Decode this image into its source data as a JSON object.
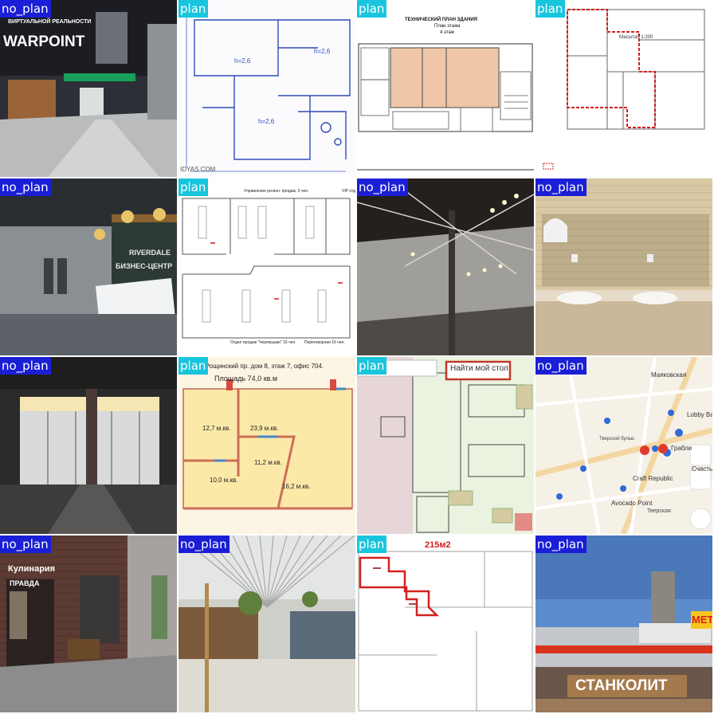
{
  "colors": {
    "plan_tag": "#18c5dd",
    "no_plan_tag": "#1a1fd6",
    "tag_text": "#ffffff"
  },
  "tiles": [
    {
      "label": "no_plan",
      "scene": "mall-storefront",
      "texts": {
        "banner": "WARPOINT",
        "banner_small": "ВИРТУАЛЬНОЙ РЕАЛЬНОСТИ"
      }
    },
    {
      "label": "plan",
      "scene": "hand-drawn-floor-plan",
      "texts": {
        "watermark": "IDYAS.COM",
        "h1": "h=2,6",
        "h2": "h=2,6",
        "h3": "h=2,6"
      }
    },
    {
      "label": "plan",
      "scene": "technical-floor-plan",
      "texts": {
        "title": "ТЕХНИЧЕСКИЙ ПЛАН ЗДАНИЯ",
        "subtitle": "План этажа",
        "floor": "4 этаж"
      }
    },
    {
      "label": "plan",
      "scene": "outlined-floor-plan",
      "texts": {
        "scale": "Масштаб 1:200"
      }
    },
    {
      "label": "no_plan",
      "scene": "business-center-lobby",
      "texts": {
        "sign1": "RIVERDALE",
        "sign2": "БИЗНЕС-ЦЕНТР"
      }
    },
    {
      "label": "plan",
      "scene": "office-layout-plan",
      "texts": {
        "room1": "Управление регион. продаж, 3 чел.",
        "room2": "VIP отд.",
        "room3": "Отдел продаж \"Черемушки\" 16 чел.",
        "room4": "Переговорная 16 чел."
      }
    },
    {
      "label": "no_plan",
      "scene": "empty-hall-track-lights",
      "texts": {}
    },
    {
      "label": "no_plan",
      "scene": "tiled-restroom",
      "texts": {}
    },
    {
      "label": "no_plan",
      "scene": "glass-entrance",
      "texts": {}
    },
    {
      "label": "plan",
      "scene": "colored-office-plan",
      "texts": {
        "header": "2-й Рощинский пр. дом 8, этаж 7, офис 704.",
        "area": "Площадь 74,0 кв.м",
        "r1": "12,7 м.кв.",
        "r2": "23,9 м.кв.",
        "r3": "11,2 м.кв.",
        "r4": "10,0 м.кв.",
        "r5": "16,2 м.кв."
      }
    },
    {
      "label": "plan",
      "scene": "desk-booking-plan",
      "texts": {
        "button": "Найти мой стол"
      }
    },
    {
      "label": "no_plan",
      "scene": "city-map",
      "texts": {
        "p1": "Маяковская",
        "p2": "Lobby Bar",
        "p3": "Грабли",
        "p4": "Счастье",
        "p5": "Craft Republic",
        "p6": "Avocado Point",
        "p7": "Тверской бульв.",
        "p8": "Тверская"
      }
    },
    {
      "label": "no_plan",
      "scene": "brick-building-facade",
      "texts": {
        "sign1": "Кулинария",
        "sign2": "ПРАВДА"
      }
    },
    {
      "label": "no_plan",
      "scene": "mall-food-court",
      "texts": {}
    },
    {
      "label": "plan",
      "scene": "area-outline-plan",
      "texts": {
        "area": "215м2"
      }
    },
    {
      "label": "no_plan",
      "scene": "mall-exterior",
      "texts": {
        "sign": "СТАНКОЛИТ",
        "brand": "МЕТ"
      }
    }
  ]
}
